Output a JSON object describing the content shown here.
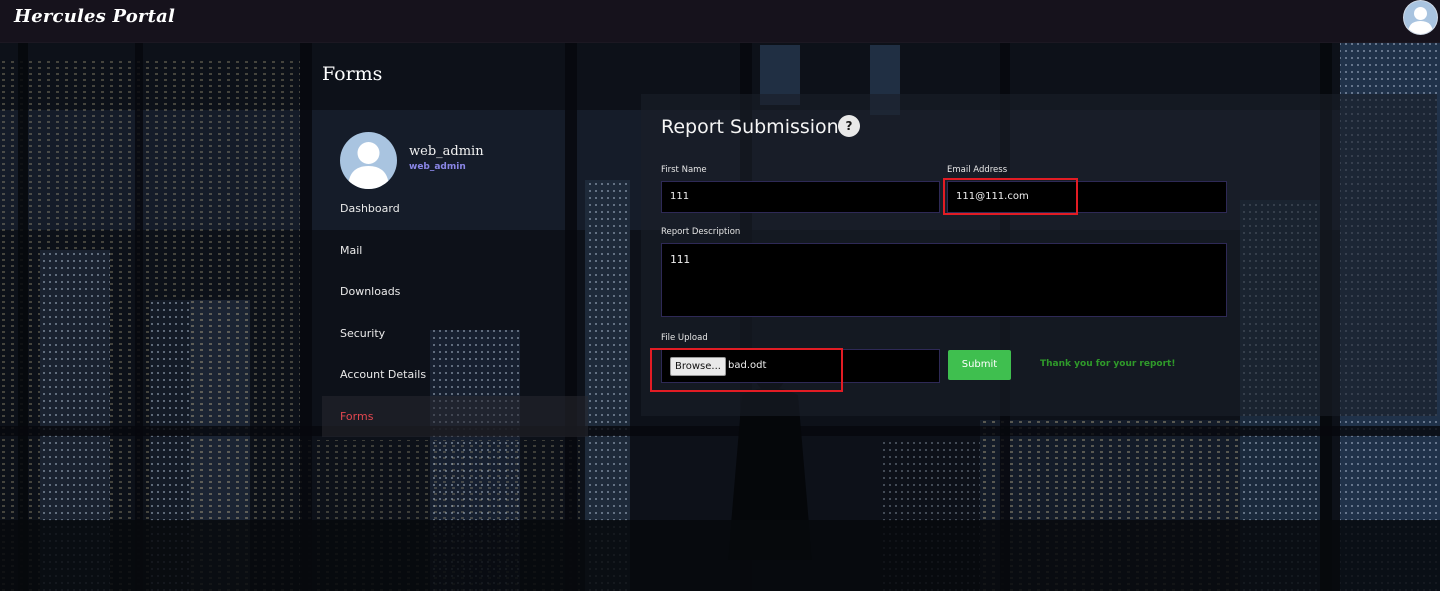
{
  "app": {
    "title": "Hercules Portal"
  },
  "page": {
    "title": "Forms"
  },
  "profile": {
    "name": "web_admin",
    "role": "web_admin"
  },
  "sidebar": {
    "items": [
      {
        "label": "Dashboard",
        "active": false
      },
      {
        "label": "Mail",
        "active": false
      },
      {
        "label": "Downloads",
        "active": false
      },
      {
        "label": "Security",
        "active": false
      },
      {
        "label": "Account Details",
        "active": false
      },
      {
        "label": "Forms",
        "active": true
      }
    ]
  },
  "form": {
    "title": "Report Submission",
    "help_icon_glyph": "?",
    "first_name": {
      "label": "First Name",
      "value": "111"
    },
    "email": {
      "label": "Email Address",
      "value": "111@111.com"
    },
    "description": {
      "label": "Report Description",
      "value": "111"
    },
    "file_upload": {
      "label": "File Upload",
      "browse_label": "Browse...",
      "file_name": "bad.odt"
    },
    "submit_label": "Submit",
    "success_message": "Thank you for your report!"
  },
  "colors": {
    "accent_active_nav": "#e1474f",
    "submit_green": "#3fbf4f",
    "success_text": "#2f9a2a",
    "role_text": "#8a86e6",
    "highlight_box": "#e21c24"
  },
  "icons": {
    "top_avatar": "user-avatar-icon",
    "profile_avatar": "user-avatar-icon",
    "help": "question-mark-icon"
  }
}
